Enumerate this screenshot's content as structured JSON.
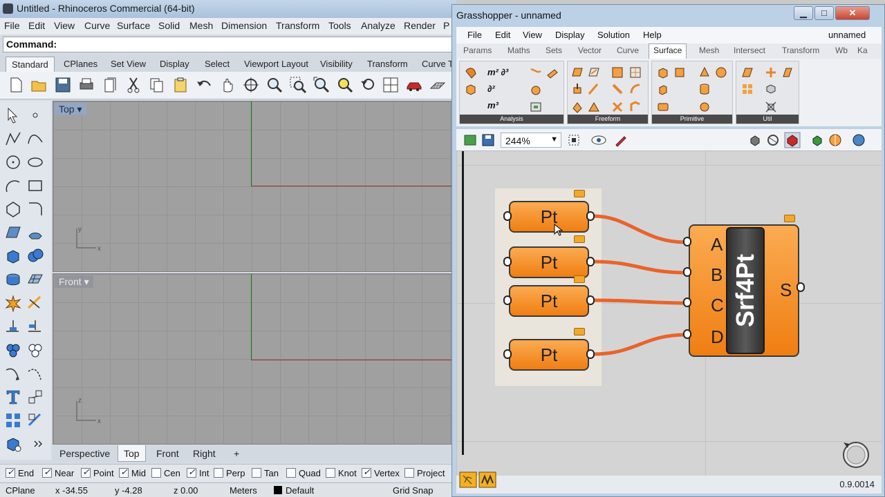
{
  "rhino": {
    "title": "Untitled - Rhinoceros Commercial (64-bit)",
    "menu": [
      "File",
      "Edit",
      "View",
      "Curve",
      "Surface",
      "Solid",
      "Mesh",
      "Dimension",
      "Transform",
      "Tools",
      "Analyze",
      "Render",
      "P"
    ],
    "command_label": "Command:",
    "toolbar_tabs": [
      "Standard",
      "CPlanes",
      "Set View",
      "Display",
      "Select",
      "Viewport Layout",
      "Visibility",
      "Transform",
      "Curve T"
    ],
    "active_toolbar_tab": "Standard",
    "viewports": {
      "top": "Top",
      "front": "Front"
    },
    "viewport_tabs": [
      "Perspective",
      "Top",
      "Front",
      "Right",
      "+"
    ],
    "active_viewport_tab": "Top",
    "osnaps": [
      {
        "label": "End",
        "checked": true
      },
      {
        "label": "Near",
        "checked": true
      },
      {
        "label": "Point",
        "checked": true
      },
      {
        "label": "Mid",
        "checked": true
      },
      {
        "label": "Cen",
        "checked": false
      },
      {
        "label": "Int",
        "checked": true
      },
      {
        "label": "Perp",
        "checked": false
      },
      {
        "label": "Tan",
        "checked": false
      },
      {
        "label": "Quad",
        "checked": false
      },
      {
        "label": "Knot",
        "checked": false
      },
      {
        "label": "Vertex",
        "checked": true
      },
      {
        "label": "Project",
        "checked": false
      }
    ],
    "status": {
      "cplane": "CPlane",
      "x": "x -34.55",
      "y": "y -4.28",
      "z": "z 0.00",
      "units": "Meters",
      "layer": "Default",
      "grid_snap": "Grid Snap"
    }
  },
  "grasshopper": {
    "title": "Grasshopper - unnamed",
    "doc_name": "unnamed",
    "menu": [
      "File",
      "Edit",
      "View",
      "Display",
      "Solution",
      "Help"
    ],
    "tabs": [
      "Params",
      "Maths",
      "Sets",
      "Vector",
      "Curve",
      "Surface",
      "Mesh",
      "Intersect",
      "Transform",
      "Wb",
      "Ka"
    ],
    "active_tab": "Surface",
    "ribbon_groups": [
      "Analysis",
      "Freeform",
      "Primitive",
      "Util"
    ],
    "zoom": "244%",
    "components": {
      "pt_label": "Pt",
      "srf_name": "Srf4Pt",
      "inputs": [
        "A",
        "B",
        "C",
        "D"
      ],
      "output": "S"
    },
    "version": "0.9.0014"
  },
  "colors": {
    "wire": "#e8642a",
    "component": "#f39a2e",
    "accent": "#4a86c8"
  }
}
